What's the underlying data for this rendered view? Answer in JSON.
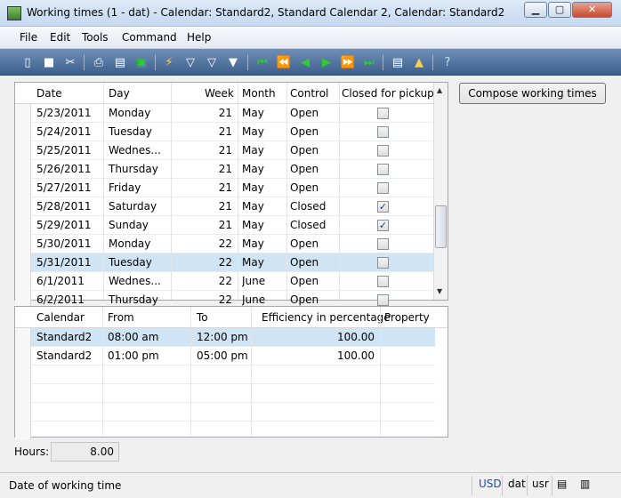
{
  "window": {
    "title": "Working times (1 - dat) - Calendar: Standard2, Standard Calendar 2, Calendar: Standard2",
    "min_icon": "minimize-icon",
    "max_icon": "maximize-icon",
    "close_icon": "close-icon"
  },
  "menu": [
    "File",
    "Edit",
    "Tools",
    "Command",
    "Help"
  ],
  "toolbar": {
    "icons": [
      "new-icon",
      "save-icon",
      "cut-icon",
      "print-icon",
      "print-preview-icon",
      "excel-icon",
      "filter-lightning-icon",
      "filter-icon",
      "filter-clear-icon",
      "funnel-icon",
      "first-record-icon",
      "prev-page-icon",
      "prev-record-icon",
      "next-record-icon",
      "next-page-icon",
      "last-record-icon",
      "document-icon",
      "alert-icon",
      "help-icon"
    ]
  },
  "top_grid": {
    "columns": [
      "Date",
      "Day",
      "Week",
      "Month",
      "Control",
      "Closed for pickup"
    ],
    "rows": [
      {
        "date": "5/23/2011",
        "day": "Monday",
        "week": "21",
        "month": "May",
        "control": "Open",
        "closed": false
      },
      {
        "date": "5/24/2011",
        "day": "Tuesday",
        "week": "21",
        "month": "May",
        "control": "Open",
        "closed": false
      },
      {
        "date": "5/25/2011",
        "day": "Wednes...",
        "week": "21",
        "month": "May",
        "control": "Open",
        "closed": false
      },
      {
        "date": "5/26/2011",
        "day": "Thursday",
        "week": "21",
        "month": "May",
        "control": "Open",
        "closed": false
      },
      {
        "date": "5/27/2011",
        "day": "Friday",
        "week": "21",
        "month": "May",
        "control": "Open",
        "closed": false
      },
      {
        "date": "5/28/2011",
        "day": "Saturday",
        "week": "21",
        "month": "May",
        "control": "Closed",
        "closed": true
      },
      {
        "date": "5/29/2011",
        "day": "Sunday",
        "week": "21",
        "month": "May",
        "control": "Closed",
        "closed": true
      },
      {
        "date": "5/30/2011",
        "day": "Monday",
        "week": "22",
        "month": "May",
        "control": "Open",
        "closed": false
      },
      {
        "date": "5/31/2011",
        "day": "Tuesday",
        "week": "22",
        "month": "May",
        "control": "Open",
        "closed": false
      },
      {
        "date": "6/1/2011",
        "day": "Wednes...",
        "week": "22",
        "month": "June",
        "control": "Open",
        "closed": false
      },
      {
        "date": "6/2/2011",
        "day": "Thursday",
        "week": "22",
        "month": "June",
        "control": "Open",
        "closed": false
      }
    ]
  },
  "bottom_grid": {
    "columns": [
      "Calendar",
      "From",
      "To",
      "Efficiency in percentage",
      "Property"
    ],
    "rows": [
      {
        "calendar": "Standard2",
        "from": "08:00 am",
        "to": "12:00 pm",
        "efficiency": "100.00",
        "property": ""
      },
      {
        "calendar": "Standard2",
        "from": "01:00 pm",
        "to": "05:00 pm",
        "efficiency": "100.00",
        "property": ""
      }
    ]
  },
  "compose_button": "Compose working times",
  "hours": {
    "label": "Hours:",
    "value": "8.00"
  },
  "status": {
    "text": "Date of working time",
    "currency": "USD",
    "company": "dat",
    "user": "usr"
  }
}
